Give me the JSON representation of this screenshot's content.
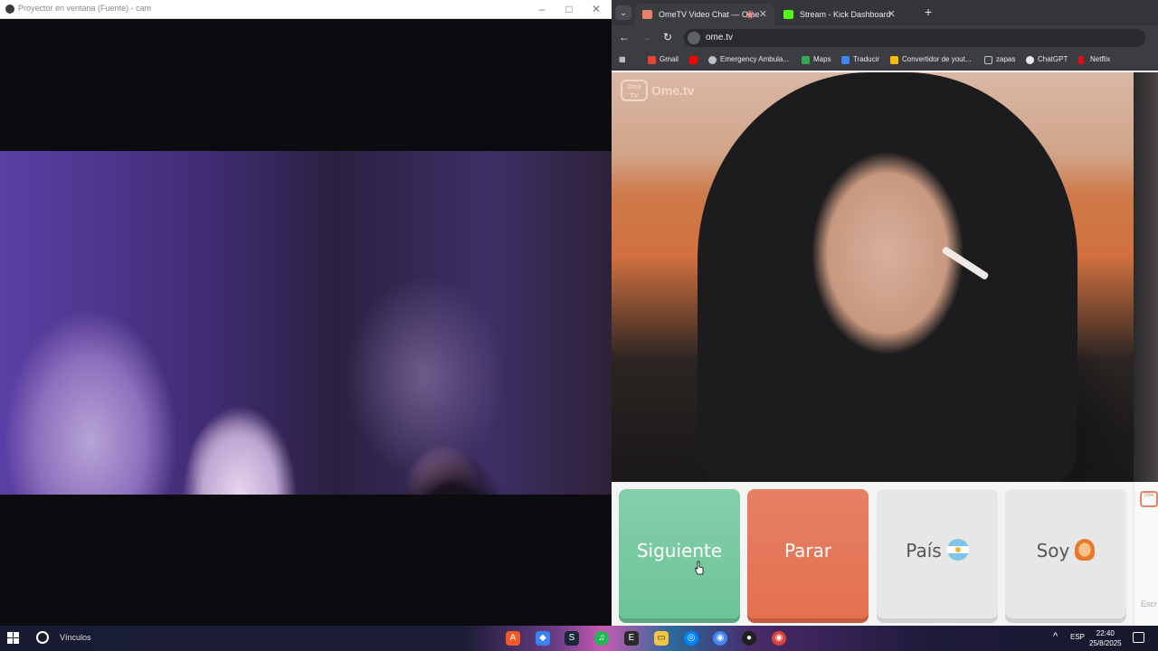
{
  "projector_window": {
    "title": "Proyector en ventana (Fuente) - cam"
  },
  "browser": {
    "tabs": [
      {
        "label": "OmeTV Video Chat — Ome",
        "favicon_color": "#e9806a",
        "active": true
      },
      {
        "label": "Stream - Kick Dashboard",
        "favicon_color": "#53fc18",
        "active": false
      }
    ],
    "url": "ome.tv",
    "bookmarks": [
      {
        "label": "Gmail",
        "color": "#ea4335"
      },
      {
        "label": "",
        "color": "#ff0000"
      },
      {
        "label": "Emergency Ambula...",
        "color": "#bdc1c6"
      },
      {
        "label": "Maps",
        "color": "#34a853"
      },
      {
        "label": "Traducir",
        "color": "#4285f4"
      },
      {
        "label": "Convertidor de yout...",
        "color": "#fbbc05"
      },
      {
        "label": "zapas",
        "color": "#bdc1c6"
      },
      {
        "label": "ChatGPT",
        "color": "#e8eaed"
      },
      {
        "label": "Netflix",
        "color": "#e50914"
      }
    ]
  },
  "ometv": {
    "logo_badge": "Ome TV",
    "logo_text": "Ome.tv",
    "buttons": {
      "next": "Siguiente",
      "stop": "Parar",
      "country": "País",
      "gender": "Soy"
    },
    "chat_placeholder": "Escr",
    "mini_logo": "Ome"
  },
  "taskbar": {
    "search_label": "Vínculos",
    "language": "ESP",
    "time": "22:40",
    "date": "25/8/2025",
    "apps": [
      {
        "name": "adobe-acrobat",
        "color": "#f15a24",
        "glyph": "A"
      },
      {
        "name": "steam",
        "color": "#1b2838",
        "glyph": "S"
      },
      {
        "name": "spotify",
        "color": "#1db954",
        "glyph": "♫"
      },
      {
        "name": "epic-games",
        "color": "#2a2a2a",
        "glyph": "E"
      },
      {
        "name": "file-explorer",
        "color": "#f4c542",
        "glyph": "▭"
      },
      {
        "name": "messenger",
        "color": "#0084ff",
        "glyph": "◎"
      },
      {
        "name": "chrome",
        "color": "#4285f4",
        "glyph": "◉"
      },
      {
        "name": "obs",
        "color": "#202020",
        "glyph": "●"
      },
      {
        "name": "chrome-2",
        "color": "#db4437",
        "glyph": "◉"
      }
    ]
  }
}
